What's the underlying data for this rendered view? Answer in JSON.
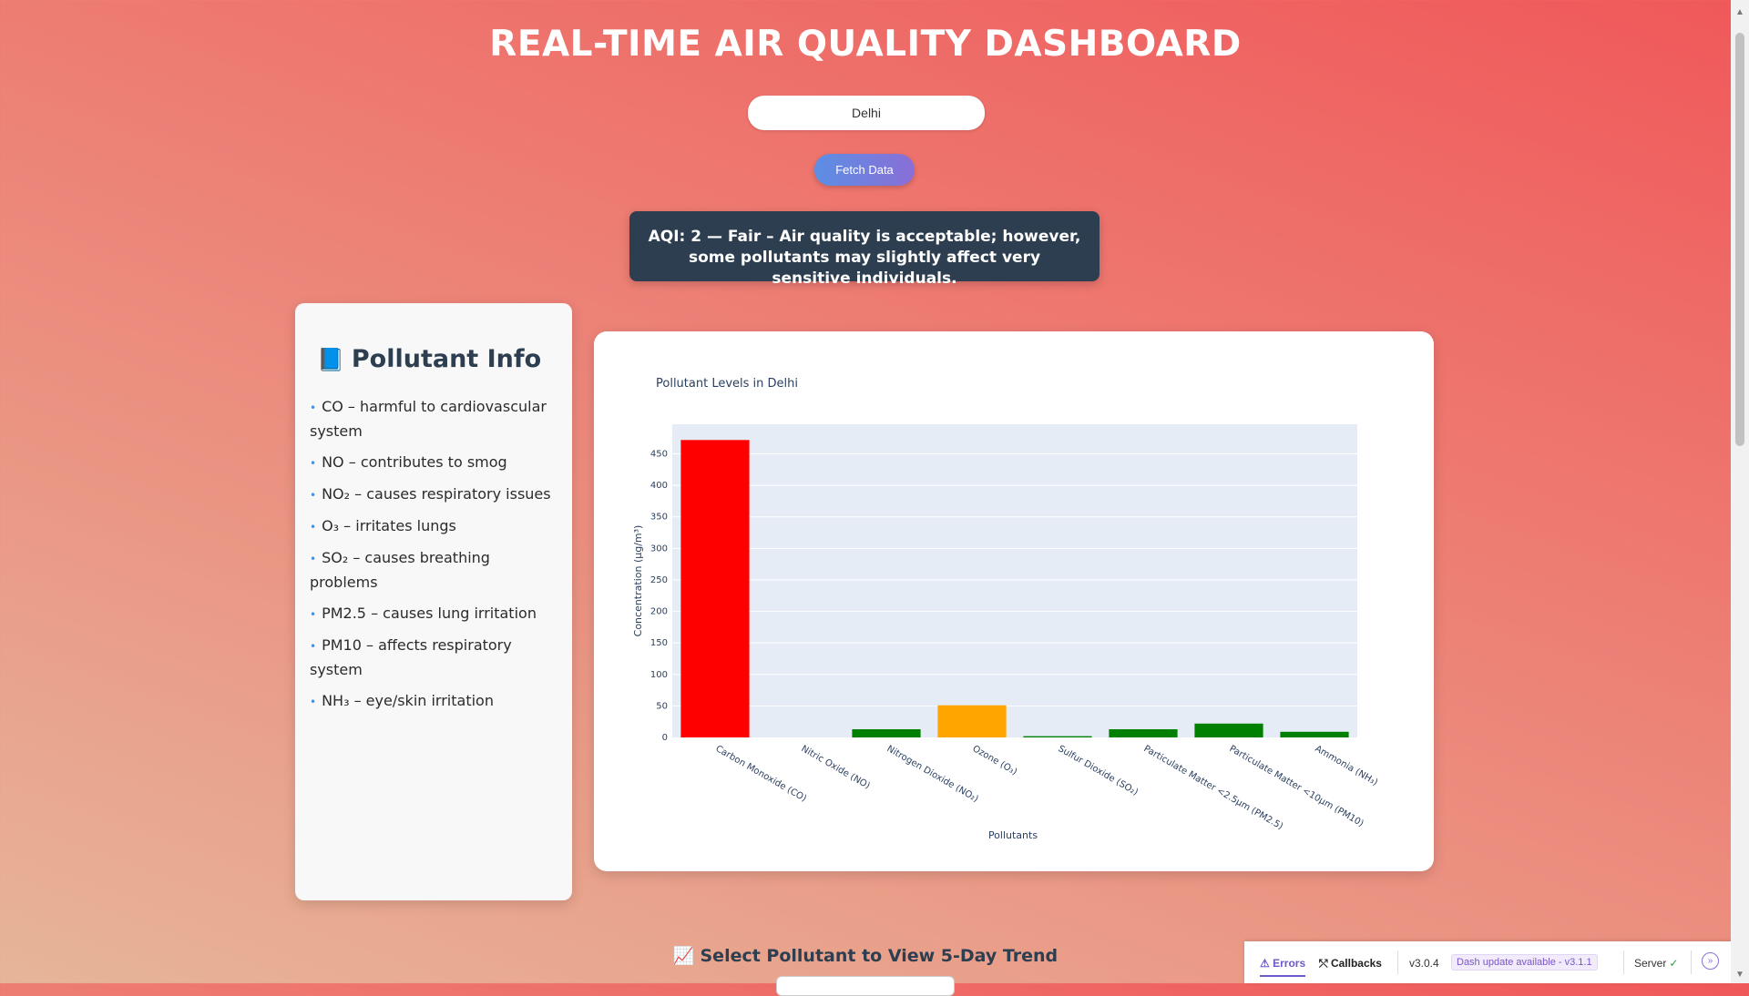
{
  "header": {
    "title": "REAL-TIME AIR QUALITY DASHBOARD"
  },
  "city_input": {
    "value": "Delhi"
  },
  "fetch_button": {
    "label": "Fetch Data"
  },
  "aqi_message": "AQI: 2 — Fair – Air quality is acceptable; however, some pollutants may slightly affect very sensitive individuals.",
  "info_panel": {
    "icon": "book-icon",
    "title": "Pollutant Info",
    "items": [
      "CO – harmful to cardiovascular system",
      "NO – contributes to smog",
      "NO₂ – causes respiratory issues",
      "O₃ – irritates lungs",
      "SO₂ – causes breathing problems",
      "PM2.5 – causes lung irritation",
      "PM10 – affects respiratory system",
      "NH₃ – eye/skin irritation"
    ]
  },
  "chart_data": {
    "type": "bar",
    "title": "Pollutant Levels in Delhi",
    "xlabel": "Pollutants",
    "ylabel": "Concentration (µg/m³)",
    "categories": [
      "Carbon Monoxide (CO)",
      "Nitric Oxide (NO)",
      "Nitrogen Dioxide (NO₂)",
      "Ozone (O₃)",
      "Sulfur Dioxide (SO₂)",
      "Particulate Matter <2.5µm (PM2.5)",
      "Particulate Matter <10µm (PM10)",
      "Ammonia (NH₃)"
    ],
    "values": [
      472,
      0,
      13,
      51,
      2,
      13,
      22,
      9
    ],
    "colors": [
      "#ff0000",
      "#008000",
      "#008000",
      "#ffa500",
      "#008000",
      "#008000",
      "#008000",
      "#008000"
    ],
    "ylim": [
      0,
      497
    ],
    "yticks": [
      0,
      50,
      100,
      150,
      200,
      250,
      300,
      350,
      400,
      450
    ],
    "grid": true
  },
  "trend": {
    "icon": "chart-increasing-icon",
    "label": "Select Pollutant to View 5-Day Trend"
  },
  "devtools": {
    "errors": "Errors",
    "callbacks": "Callbacks",
    "version": "v3.0.4",
    "update": "Dash update available - v3.1.1",
    "server": "Server"
  },
  "colors": {
    "aqi_box": "#2c3e50",
    "accent": "#4a90e2"
  }
}
